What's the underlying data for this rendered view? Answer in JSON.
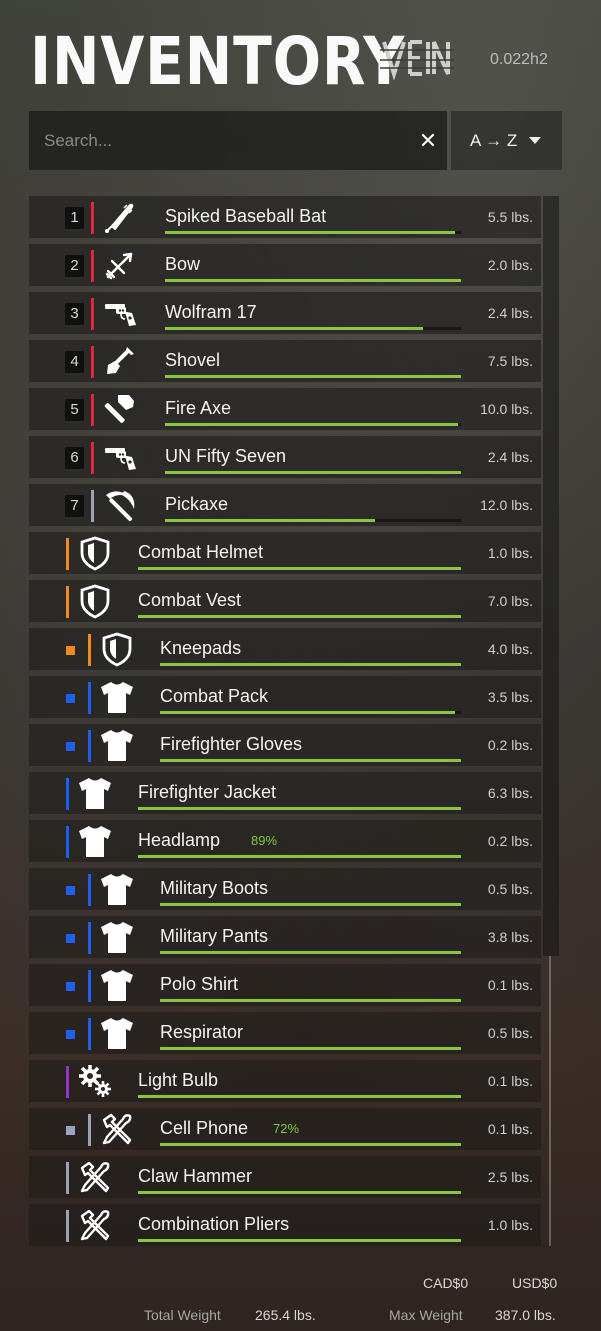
{
  "header": {
    "title": "INVENTORY",
    "logo_text": "VEIN",
    "version": "0.022h2"
  },
  "search": {
    "placeholder": "Search...",
    "value": "",
    "clear_label": "✕",
    "sort_label": "A → Z"
  },
  "items": [
    {
      "slot": "1",
      "name": "Spiked Baseball Bat",
      "weight": "5.5 lbs.",
      "icon": "bat-icon",
      "bar_color": "#e0283c",
      "marker_color": "",
      "condition": 0.98
    },
    {
      "slot": "2",
      "name": "Bow",
      "weight": "2.0 lbs.",
      "icon": "bow-arrow-icon",
      "bar_color": "#e0283c",
      "marker_color": "",
      "condition": 1.0
    },
    {
      "slot": "3",
      "name": "Wolfram 17",
      "weight": "2.4 lbs.",
      "icon": "revolver-icon",
      "bar_color": "#e0283c",
      "marker_color": "",
      "condition": 0.87
    },
    {
      "slot": "4",
      "name": "Shovel",
      "weight": "7.5 lbs.",
      "icon": "shovel-icon",
      "bar_color": "#e0283c",
      "marker_color": "",
      "condition": 1.0
    },
    {
      "slot": "5",
      "name": "Fire Axe",
      "weight": "10.0 lbs.",
      "icon": "axe-icon",
      "bar_color": "#e0283c",
      "marker_color": "",
      "condition": 0.99
    },
    {
      "slot": "6",
      "name": "UN Fifty Seven",
      "weight": "2.4 lbs.",
      "icon": "revolver-icon",
      "bar_color": "#e0283c",
      "marker_color": "",
      "condition": 1.0
    },
    {
      "slot": "7",
      "name": "Pickaxe",
      "weight": "12.0 lbs.",
      "icon": "pickaxe-icon",
      "bar_color": "#9aa3b5",
      "marker_color": "",
      "condition": 0.71
    },
    {
      "slot": "",
      "name": "Combat Helmet",
      "weight": "1.0 lbs.",
      "icon": "armor-shield-icon",
      "bar_color": "#f08a1e",
      "marker_color": "",
      "condition": 1.0
    },
    {
      "slot": "",
      "name": "Combat Vest",
      "weight": "7.0 lbs.",
      "icon": "armor-shield-icon",
      "bar_color": "#f08a1e",
      "marker_color": "",
      "condition": 1.0
    },
    {
      "slot": "",
      "name": "Kneepads",
      "weight": "4.0 lbs.",
      "icon": "armor-shield-icon",
      "bar_color": "#f08a1e",
      "marker_color": "#f08a1e",
      "condition": 1.0
    },
    {
      "slot": "",
      "name": "Combat Pack",
      "weight": "3.5 lbs.",
      "icon": "shirt-icon",
      "bar_color": "#1e5ef0",
      "marker_color": "#1e5ef0",
      "condition": 0.98
    },
    {
      "slot": "",
      "name": "Firefighter Gloves",
      "weight": "0.2 lbs.",
      "icon": "shirt-icon",
      "bar_color": "#1e5ef0",
      "marker_color": "#1e5ef0",
      "condition": 1.0
    },
    {
      "slot": "",
      "name": "Firefighter Jacket",
      "weight": "6.3 lbs.",
      "icon": "shirt-icon",
      "bar_color": "#1e5ef0",
      "marker_color": "",
      "condition": 1.0
    },
    {
      "slot": "",
      "name": "Headlamp",
      "weight": "0.2 lbs.",
      "icon": "shirt-icon",
      "bar_color": "#1e5ef0",
      "marker_color": "",
      "condition": 1.0,
      "percent": "89%"
    },
    {
      "slot": "",
      "name": "Military Boots",
      "weight": "0.5 lbs.",
      "icon": "shirt-icon",
      "bar_color": "#1e5ef0",
      "marker_color": "#1e5ef0",
      "condition": 1.0
    },
    {
      "slot": "",
      "name": "Military Pants",
      "weight": "3.8 lbs.",
      "icon": "shirt-icon",
      "bar_color": "#1e5ef0",
      "marker_color": "#1e5ef0",
      "condition": 1.0
    },
    {
      "slot": "",
      "name": "Polo Shirt",
      "weight": "0.1 lbs.",
      "icon": "shirt-icon",
      "bar_color": "#1e5ef0",
      "marker_color": "#1e5ef0",
      "condition": 1.0
    },
    {
      "slot": "",
      "name": "Respirator",
      "weight": "0.5 lbs.",
      "icon": "shirt-icon",
      "bar_color": "#1e5ef0",
      "marker_color": "#1e5ef0",
      "condition": 1.0
    },
    {
      "slot": "",
      "name": "Light Bulb",
      "weight": "0.1 lbs.",
      "icon": "gears-icon",
      "bar_color": "#9b2fc9",
      "marker_color": "",
      "condition": 1.0
    },
    {
      "slot": "",
      "name": "Cell Phone",
      "weight": "0.1 lbs.",
      "icon": "tools-icon",
      "bar_color": "#9aa3b5",
      "marker_color": "#9aa3c0",
      "condition": 1.0,
      "percent": "72%"
    },
    {
      "slot": "",
      "name": "Claw Hammer",
      "weight": "2.5 lbs.",
      "icon": "tools-icon",
      "bar_color": "#9aa3b5",
      "marker_color": "",
      "condition": 1.0
    },
    {
      "slot": "",
      "name": "Combination Pliers",
      "weight": "1.0 lbs.",
      "icon": "tools-icon",
      "bar_color": "#9aa3b5",
      "marker_color": "",
      "condition": 1.0
    }
  ],
  "footer": {
    "cad": "CAD$0",
    "usd": "USD$0",
    "total_weight_label": "Total Weight",
    "total_weight": "265.4 lbs.",
    "max_weight_label": "Max Weight",
    "max_weight": "387.0 lbs."
  }
}
